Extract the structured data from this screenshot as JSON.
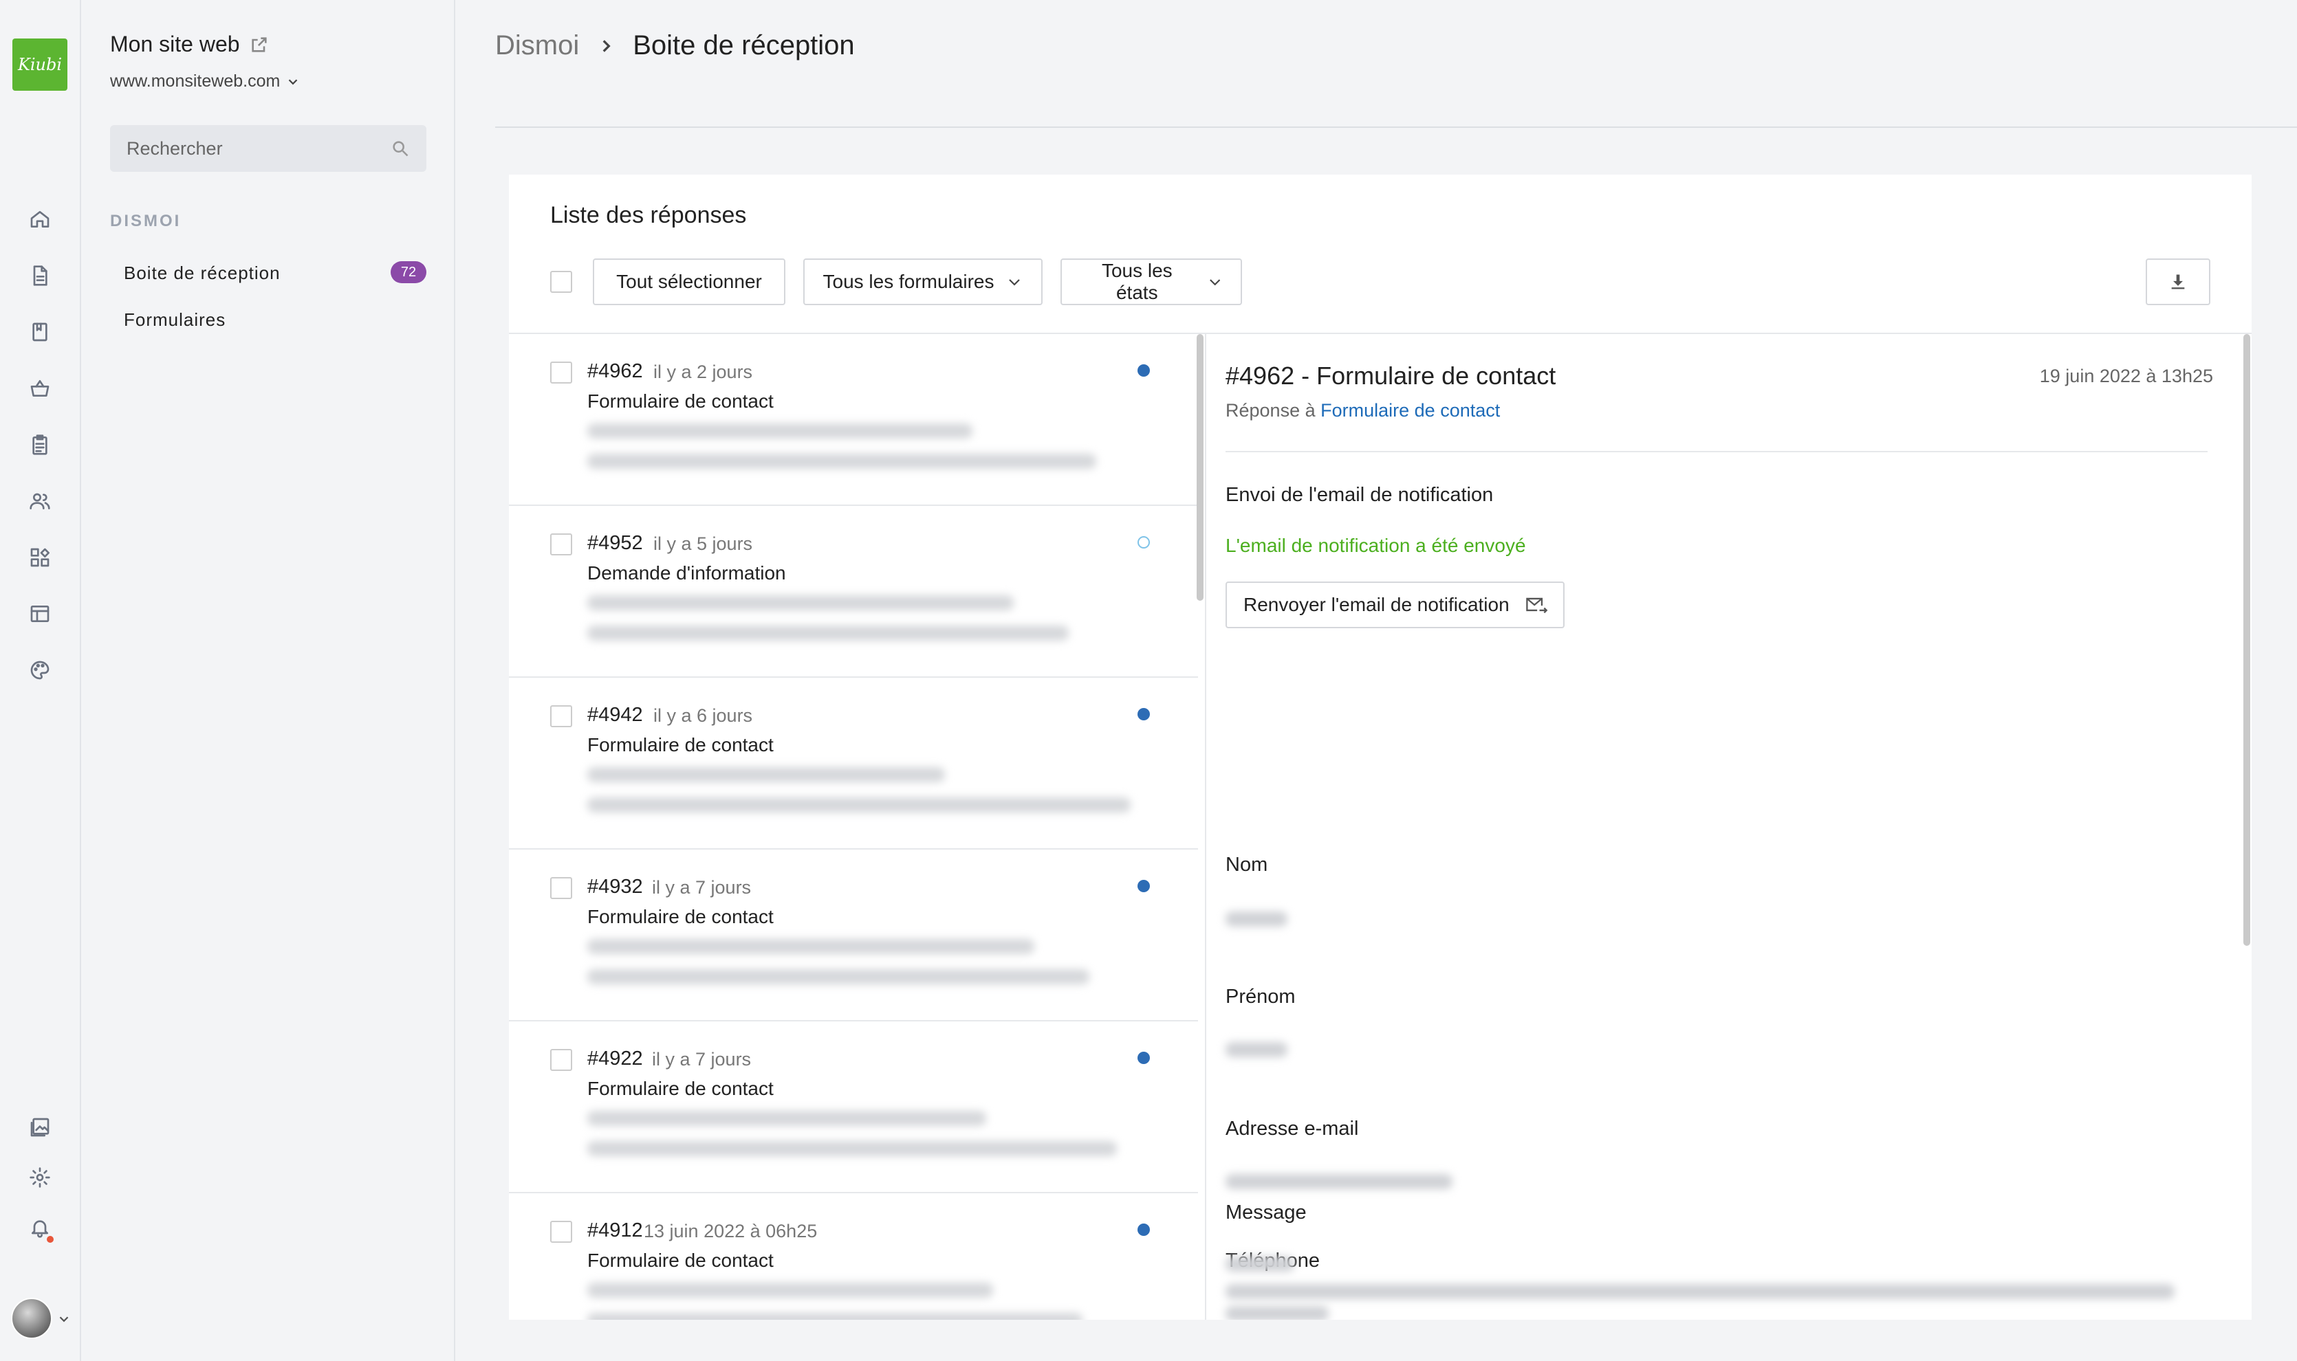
{
  "app": {
    "logo_text": "Kiubi",
    "site_title": "Mon site web",
    "site_url": "www.monsiteweb.com"
  },
  "rail": {
    "icons": [
      "home-icon",
      "page-icon",
      "book-icon",
      "basket-icon",
      "clipboard-icon",
      "users-icon",
      "apps-icon",
      "layout-icon",
      "palette-icon",
      "media-icon",
      "gear-icon",
      "bell-icon"
    ]
  },
  "sidebar": {
    "search_placeholder": "Rechercher",
    "section": "DISMOI",
    "items": [
      {
        "label": "Boite de réception",
        "badge": "72"
      },
      {
        "label": "Formulaires"
      }
    ]
  },
  "breadcrumb": {
    "root": "Dismoi",
    "current": "Boite de réception"
  },
  "list": {
    "title": "Liste des réponses",
    "select_all": "Tout sélectionner",
    "filter_forms": "Tous les formulaires",
    "filter_states": "Tous les états",
    "items": [
      {
        "num": "#4962",
        "time": "il y a 2 jours",
        "form": "Formulaire de contact",
        "unread": true
      },
      {
        "num": "#4952",
        "time": "il y a 5 jours",
        "form": "Demande d'information",
        "unread": false
      },
      {
        "num": "#4942",
        "time": "il y a 6 jours",
        "form": "Formulaire de contact",
        "unread": true
      },
      {
        "num": "#4932",
        "time": "il y a 7 jours",
        "form": "Formulaire de contact",
        "unread": true
      },
      {
        "num": "#4922",
        "time": "il y a 7 jours",
        "form": "Formulaire de contact",
        "unread": true
      },
      {
        "num": "#4912",
        "time": "13 juin 2022 à 06h25",
        "form": "Formulaire de contact",
        "unread": true
      }
    ]
  },
  "detail": {
    "title": "#4962 - Formulaire de contact",
    "date": "19 juin 2022 à 13h25",
    "reply_prefix": "Réponse à",
    "reply_link": "Formulaire de contact",
    "notif_heading": "Envoi de l'email de notification",
    "notif_status": "L'email de notification a été envoyé",
    "resend_label": "Renvoyer l'email de notification",
    "fields": [
      "Nom",
      "Prénom",
      "Adresse e-mail",
      "Téléphone",
      "Message"
    ]
  },
  "colors": {
    "brand": "#5cb531",
    "badge": "#8b4aa8",
    "link": "#1e6bb8",
    "unread_dot": "#2d6cb5",
    "success": "#4caf1f"
  }
}
